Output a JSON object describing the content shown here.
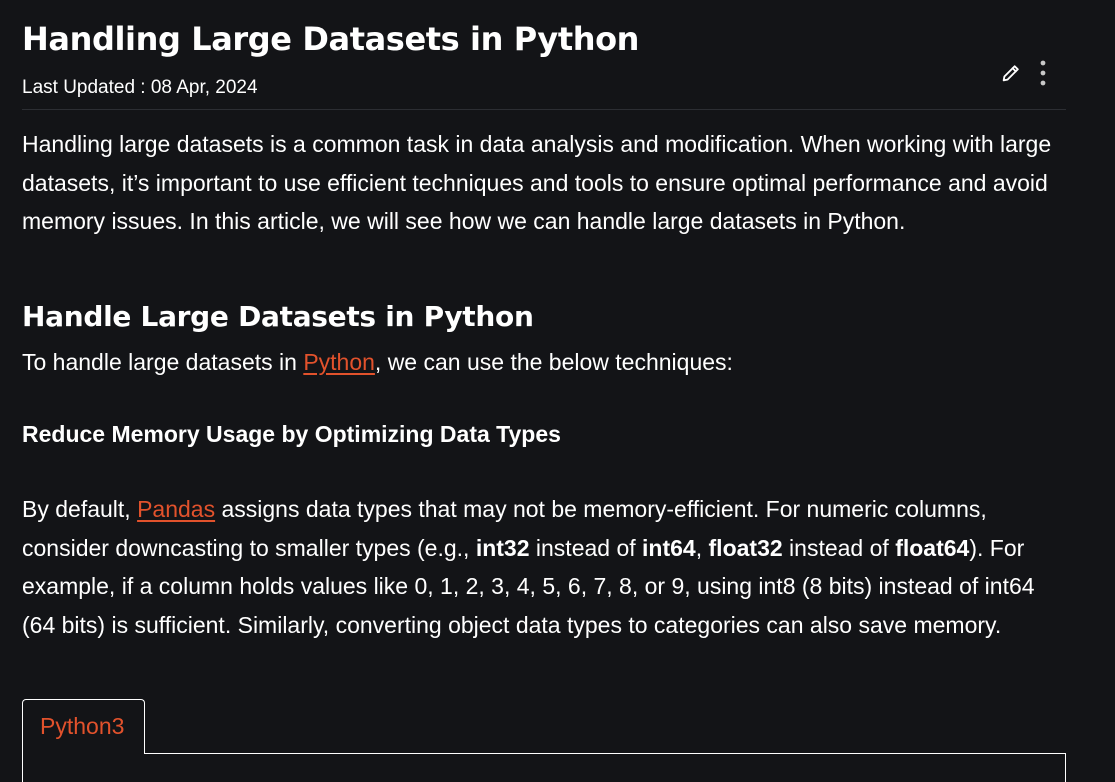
{
  "article": {
    "title": "Handling Large Datasets in Python",
    "last_updated": "Last Updated : 08 Apr, 2024",
    "intro_paragraph": "Handling large datasets is a common task in data analysis and modification. When working with large datasets, it’s important to use efficient techniques and tools to ensure optimal performance and avoid memory issues. In this article, we will see how we can handle large datasets in Python.",
    "section_heading": "Handle Large Datasets in Python",
    "section_intro_before": "To handle large datasets in ",
    "section_intro_link": "Python",
    "section_intro_after": ", we can use the below techniques:",
    "subheading": "Reduce Memory Usage by Optimizing Data Types",
    "para2": {
      "t1": "By default, ",
      "link": "Pandas",
      "t2": " assigns data types that may not be memory-efficient. For numeric columns, consider downcasting to smaller types (e.g., ",
      "b1": "int32",
      "t3": " instead of ",
      "b2": "int64",
      "t4": ", ",
      "b3": "float32",
      "t5": " instead of ",
      "b4": "float64",
      "t6": "). For example, if a column holds values like 0, 1, 2, 3, 4, 5, 6, 7, 8, or 9, using int8 (8 bits) instead of int64 (64 bits) is sufficient. Similarly, converting object data types to categories can also save memory."
    },
    "code_tab_label": "Python3"
  },
  "icons": {
    "edit": "pencil-icon",
    "more": "kebab-menu-icon"
  },
  "colors": {
    "background": "#131417",
    "text": "#ffffff",
    "link": "#e2522c"
  }
}
